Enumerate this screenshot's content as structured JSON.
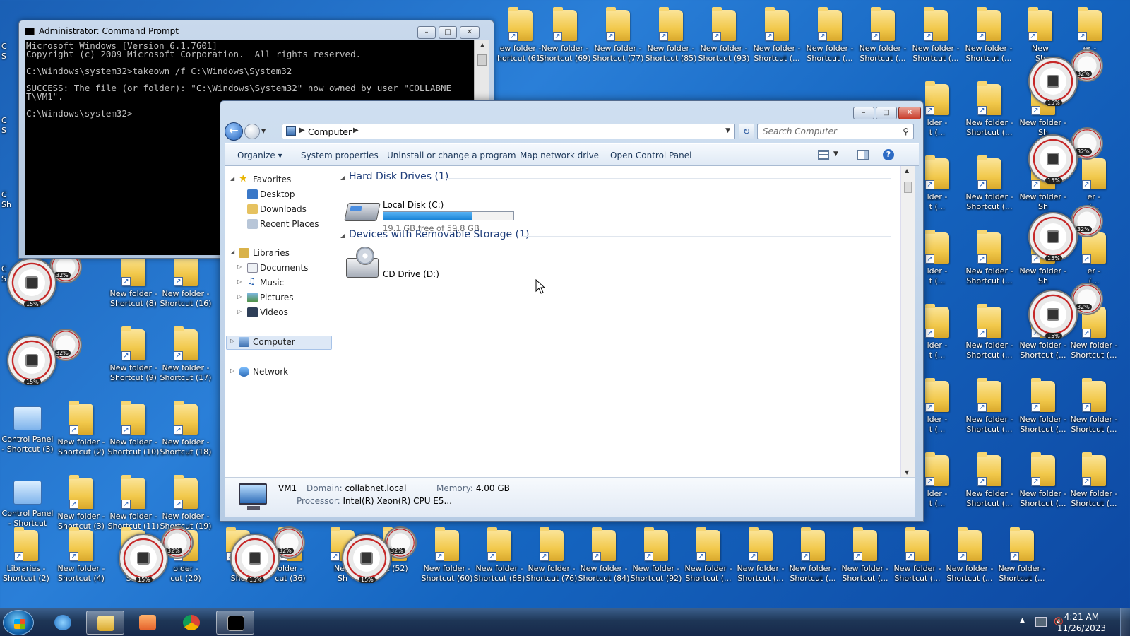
{
  "colors": {
    "desktop_bg": "#1f6fc9",
    "drive_bar_fill": "#1a84d6",
    "group_header": "#1e3d7a",
    "close_button": "#c83c2b"
  },
  "desktop": {
    "top_row_labels": [
      "ew folder -\nhortcut (61)",
      "New folder -\nShortcut (69)",
      "New folder -\nShortcut (77)",
      "New folder -\nShortcut (85)",
      "New folder -\nShortcut (93)",
      "New folder -\nShortcut (...",
      "New folder -\nShortcut (...",
      "New folder -\nShortcut (...",
      "New folder -\nShortcut (...",
      "New folder -\nShortcut (...",
      "New\nSh",
      "er -\n(..."
    ],
    "left_column": [
      {
        "label": "New folder -\nShortcut (8)",
        "type": "folder"
      },
      {
        "label": "New folder -\nShortcut (16)",
        "type": "folder"
      },
      {
        "label": "New folder -\nShortcut (9)",
        "type": "folder"
      },
      {
        "label": "New folder -\nShortcut (17)",
        "type": "folder"
      },
      {
        "label": "Control Panel\n- Shortcut (3)",
        "type": "cp"
      },
      {
        "label": "New folder -\nShortcut (2)",
        "type": "folder"
      },
      {
        "label": "New folder -\nShortcut (10)",
        "type": "folder"
      },
      {
        "label": "New folder -\nShortcut (18)",
        "type": "folder"
      },
      {
        "label": "Control Panel\n- Shortcut",
        "type": "cp"
      },
      {
        "label": "New folder -\nShortcut (3)",
        "type": "folder"
      },
      {
        "label": "New folder -\nShortcut (11)",
        "type": "folder"
      },
      {
        "label": "New folder -\nShortcut (19)",
        "type": "folder"
      }
    ],
    "bottom_row_labels": [
      "Libraries -\nShortcut (2)",
      "New folder -\nShortcut (4)",
      "Ne\nSho",
      "older -\ncut (20)",
      "Ne\nSho",
      "older -\ncut (36)",
      "New\nSh",
      "ut (52)",
      "New folder -\nShortcut (60)",
      "New folder -\nShortcut (68)",
      "New folder -\nShortcut (76)",
      "New folder -\nShortcut (84)",
      "New folder -\nShortcut (92)",
      "New folder -\nShortcut (...",
      "New folder -\nShortcut (...",
      "New folder -\nShortcut (...",
      "New folder -\nShortcut (...",
      "New folder -\nShortcut (...",
      "New folder -\nShortcut (...",
      "New folder -\nShortcut (..."
    ],
    "right_column_labels": [
      "lder -\nt (...",
      "New folder -\nShortcut (...",
      "New folder -\nSh",
      "lder -\nt (...",
      "New folder -\nShortcut (...",
      "New folder -\nSh",
      "er -\n(...",
      "lder -\nt (...",
      "New folder -\nShortcut (...",
      "New folder -\nSh",
      "er -\n(...",
      "lder -\nt (...",
      "New folder -\nShortcut (...",
      "New folder -\nShortcut (...",
      "New folder -\nShortcut (...",
      "lder -\nt (...",
      "New folder -\nShortcut (...",
      "New folder -\nShortcut (...",
      "New folder -\nShortcut (...",
      "lder -\nt (...",
      "New folder -\nShortcut (...",
      "New folder -\nShortcut (...",
      "New folder -\nShortcut (..."
    ],
    "left_partial_labels": [
      "C\nS",
      "C\nS",
      "C\nSh",
      "C\nS"
    ],
    "gadget_small_pct": "32%",
    "gadget_big_pct": "15%"
  },
  "cmd": {
    "title": "Administrator: Command Prompt",
    "lines": [
      "Microsoft Windows [Version 6.1.7601]",
      "Copyright (c) 2009 Microsoft Corporation.  All rights reserved.",
      "",
      "C:\\Windows\\system32>takeown /f C:\\Windows\\System32",
      "",
      "SUCCESS: The file (or folder): \"C:\\Windows\\System32\" now owned by user \"COLLABNE",
      "T\\VM1\".",
      "",
      "C:\\Windows\\system32>"
    ]
  },
  "explorer": {
    "address_crumb": "Computer",
    "search_placeholder": "Search Computer",
    "toolbar": {
      "organize": "Organize",
      "system_properties": "System properties",
      "uninstall": "Uninstall or change a program",
      "map_drive": "Map network drive",
      "control_panel": "Open Control Panel"
    },
    "nav": {
      "favorites": "Favorites",
      "desktop": "Desktop",
      "downloads": "Downloads",
      "recent": "Recent Places",
      "libraries": "Libraries",
      "documents": "Documents",
      "music": "Music",
      "pictures": "Pictures",
      "videos": "Videos",
      "computer": "Computer",
      "network": "Network"
    },
    "groups": {
      "hdd": "Hard Disk Drives (1)",
      "removable": "Devices with Removable Storage (1)"
    },
    "c_drive": {
      "name": "Local Disk (C:)",
      "free_text": "19.1 GB free of 59.8 GB",
      "used_fraction": 0.68
    },
    "d_drive": {
      "name": "CD Drive (D:)"
    },
    "details": {
      "computer_name": "VM1",
      "domain_label": "Domain:",
      "domain": "collabnet.local",
      "memory_label": "Memory:",
      "memory": "4.00 GB",
      "processor_label": "Processor:",
      "processor": "Intel(R) Xeon(R) CPU E5..."
    }
  },
  "taskbar": {
    "time": "4:21 AM",
    "date": "11/26/2023"
  }
}
